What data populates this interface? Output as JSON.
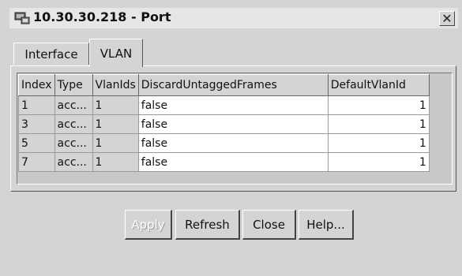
{
  "window": {
    "title": "10.30.30.218 - Port",
    "close_glyph": "✕"
  },
  "tabs": [
    {
      "label": "Interface",
      "active": false
    },
    {
      "label": "VLAN",
      "active": true
    }
  ],
  "table": {
    "columns": [
      "Index",
      "Type",
      "VlanIds",
      "DiscardUntaggedFrames",
      "DefaultVlanId"
    ],
    "rows": [
      {
        "index": "1",
        "type": "acc...",
        "vlanids": "1",
        "discard": "false",
        "default_vlan": "1"
      },
      {
        "index": "3",
        "type": "acc...",
        "vlanids": "1",
        "discard": "false",
        "default_vlan": "1"
      },
      {
        "index": "5",
        "type": "acc...",
        "vlanids": "1",
        "discard": "false",
        "default_vlan": "1"
      },
      {
        "index": "7",
        "type": "acc...",
        "vlanids": "1",
        "discard": "false",
        "default_vlan": "1"
      }
    ]
  },
  "buttons": {
    "apply": "Apply",
    "refresh": "Refresh",
    "close": "Close",
    "help": "Help..."
  },
  "colors": {
    "window_bg": "#d4d4d4",
    "editable_cell": "#ffffff",
    "disabled_text": "#ffffff"
  },
  "icons": {
    "title": "network-device-icon",
    "close": "close-icon"
  }
}
